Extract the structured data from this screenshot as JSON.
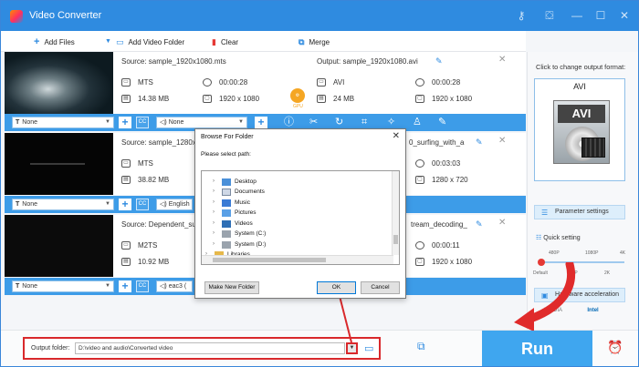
{
  "app": {
    "title": "Video Converter"
  },
  "toolbar": {
    "add_files": "Add Files",
    "add_video_folder": "Add Video Folder",
    "clear": "Clear",
    "merge": "Merge"
  },
  "rows": [
    {
      "source": "Source: sample_1920x1080.mts",
      "in_format": "MTS",
      "in_duration": "00:00:28",
      "in_size": "14.38 MB",
      "in_res": "1920 x 1080",
      "output": "Output: sample_1920x1080.avi",
      "out_format": "AVI",
      "out_duration": "00:00:28",
      "out_size": "24 MB",
      "out_res": "1920 x 1080",
      "subtitle": "None",
      "audio": "None"
    },
    {
      "source": "Source: sample_1280x7",
      "in_format": "MTS",
      "in_size": "38.82 MB",
      "output": "0_surfing_with_a",
      "out_duration": "00:03:03",
      "out_res": "1280 x 720",
      "subtitle": "None",
      "audio": "English"
    },
    {
      "source": "Source: Dependent_sub",
      "in_format": "M2TS",
      "in_size": "10.92 MB",
      "output": "tream_decoding_",
      "out_duration": "00:00:11",
      "out_res": "1920 x 1080",
      "subtitle": "None",
      "audio": "eac3 ("
    }
  ],
  "gpu_label": "GPU",
  "right_panel": {
    "click_to_change": "Click to change output format:",
    "format": "AVI",
    "format_badge": "AVI",
    "parameter_settings": "Parameter settings",
    "quick_setting": "Quick setting",
    "quality_top": [
      "480P",
      "1080P",
      "4K"
    ],
    "quality_bottom": [
      "Default",
      "720P",
      "2K"
    ],
    "hardware_acceleration": "Hardware acceleration",
    "hw_vendors": [
      "NVIDIA",
      "Intel"
    ],
    "quality_level": 0
  },
  "bottom": {
    "output_folder_label": "Output folder:",
    "output_path": "D:\\video and audio\\Converted video",
    "run": "Run"
  },
  "dialog": {
    "title": "Browse For Folder",
    "prompt": "Please select path:",
    "items": [
      "Desktop",
      "Documents",
      "Music",
      "Pictures",
      "Videos",
      "System (C:)",
      "System (D:)",
      "Libraries"
    ],
    "new_folder": "Make New Folder",
    "ok": "OK",
    "cancel": "Cancel"
  },
  "colors": {
    "accent": "#2f8be0",
    "annotation": "#d9292c",
    "run": "#3fa6ef"
  }
}
